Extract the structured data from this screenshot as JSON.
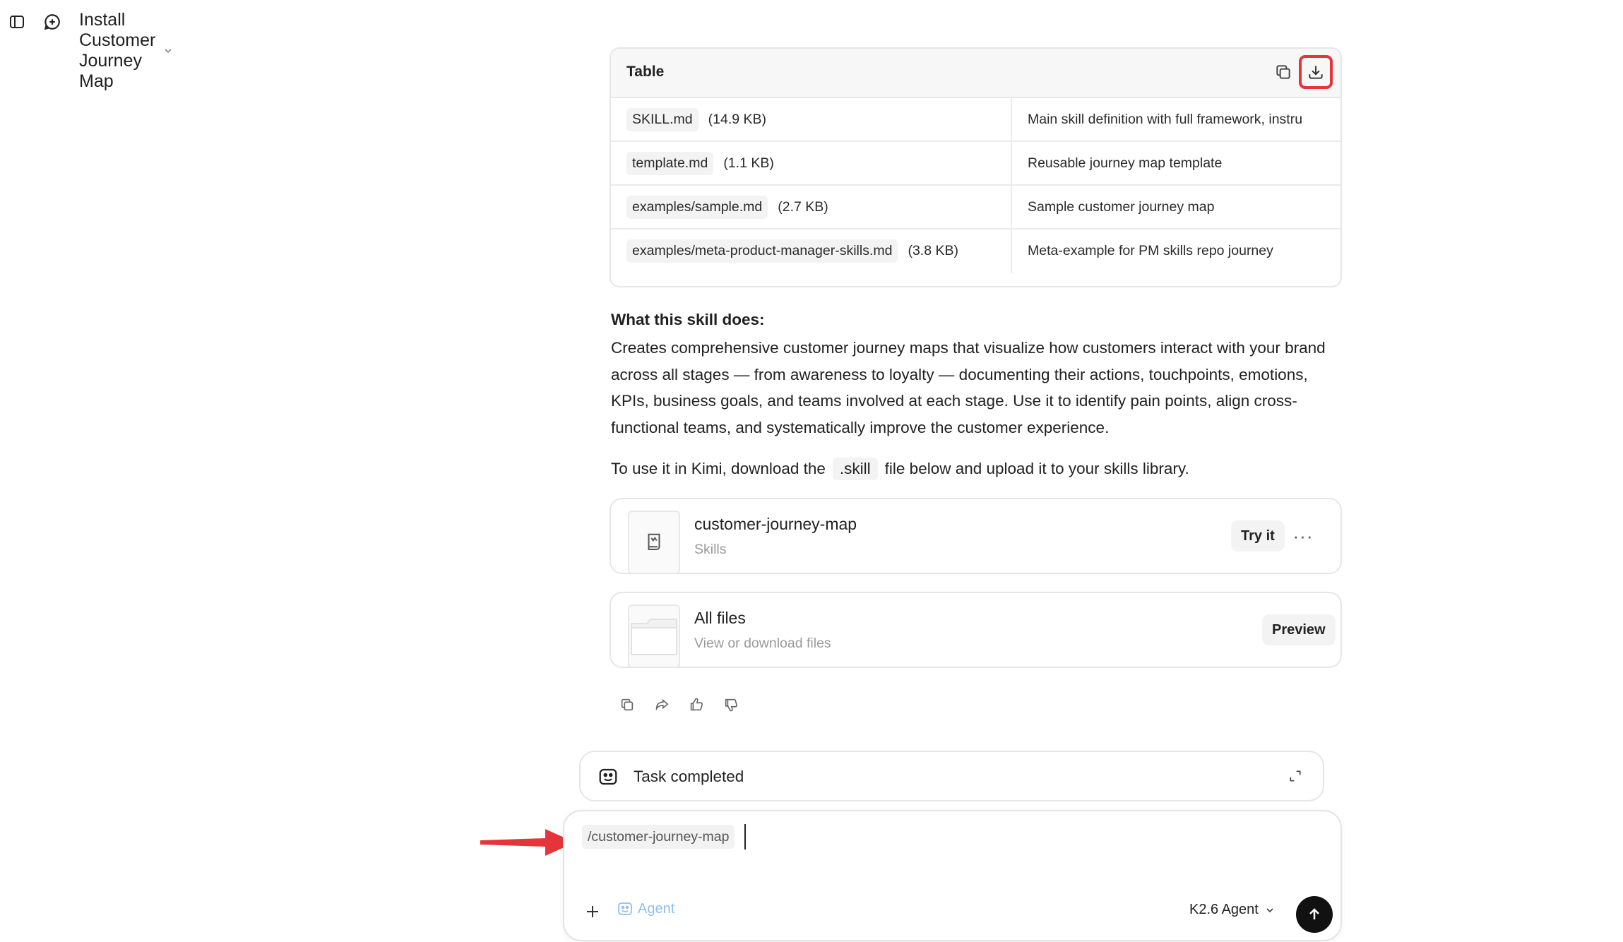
{
  "header": {
    "title": "Install Customer Journey Map"
  },
  "table": {
    "label": "Table",
    "rows": [
      {
        "file": "SKILL.md",
        "size": "(14.9 KB)",
        "description": "Main skill definition with full framework, instru"
      },
      {
        "file": "template.md",
        "size": "(1.1 KB)",
        "description": "Reusable journey map template"
      },
      {
        "file": "examples/sample.md",
        "size": "(2.7 KB)",
        "description": "Sample customer journey map"
      },
      {
        "file": "examples/meta-product-manager-skills.md",
        "size": "(3.8 KB)",
        "description": "Meta-example for PM skills repo journey"
      }
    ]
  },
  "content": {
    "section_title": "What this skill does:",
    "paragraph": "Creates comprehensive customer journey maps that visualize how customers interact with your brand across all stages — from awareness to loyalty — documenting their actions, touchpoints, emotions, KPIs, business goals, and teams involved at each stage. Use it to identify pain points, align cross-functional teams, and systematically improve the customer experience.",
    "use_prefix": "To use it in Kimi, download the",
    "use_code": ".skill",
    "use_suffix": "file below and upload it to your skills library."
  },
  "skill_card": {
    "name": "customer-journey-map",
    "type": "Skills",
    "try_label": "Try it",
    "more_label": "···"
  },
  "files_card": {
    "name": "All files",
    "subtitle": "View or download files",
    "preview_label": "Preview"
  },
  "task": {
    "label": "Task completed"
  },
  "composer": {
    "command": "/customer-journey-map",
    "agent_label": "Agent",
    "model_label": "K2.6 Agent"
  },
  "colors": {
    "highlight_red": "#e5353a",
    "agent_blue": "#8fbff0",
    "send_bg": "#111111"
  }
}
